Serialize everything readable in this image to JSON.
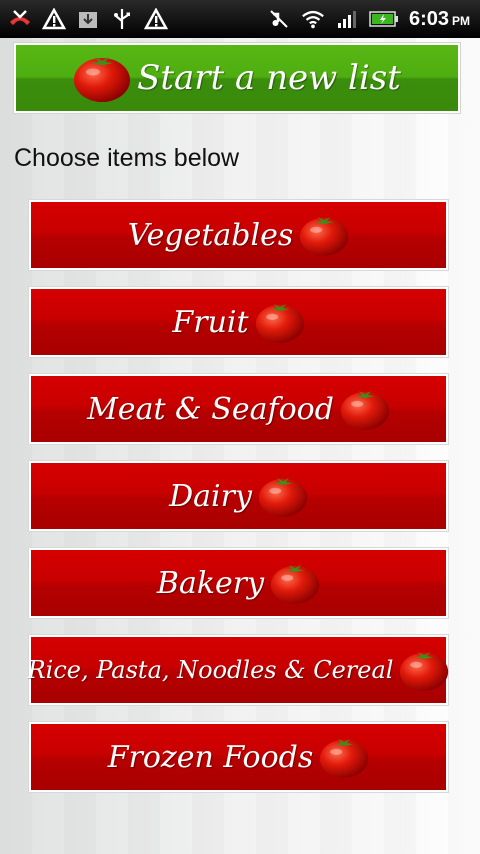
{
  "status_bar": {
    "icons_left": [
      "missed-call-icon",
      "warning-icon",
      "download-icon",
      "usb-icon",
      "warning-icon"
    ],
    "icons_right": [
      "mute-icon",
      "wifi-icon",
      "signal-icon",
      "battery-icon"
    ],
    "time": "6:03",
    "ampm": "PM"
  },
  "start_button": {
    "label": "Start a new list",
    "color": "#4fae10"
  },
  "heading": "Choose items below",
  "categories": [
    {
      "label": "Vegetables"
    },
    {
      "label": "Fruit"
    },
    {
      "label": "Meat & Seafood"
    },
    {
      "label": "Dairy"
    },
    {
      "label": "Bakery"
    },
    {
      "label": "Rice, Pasta, Noodles & Cereal"
    },
    {
      "label": "Frozen Foods"
    }
  ],
  "colors": {
    "category_red": "#c80000",
    "accent_green": "#4fae10"
  }
}
